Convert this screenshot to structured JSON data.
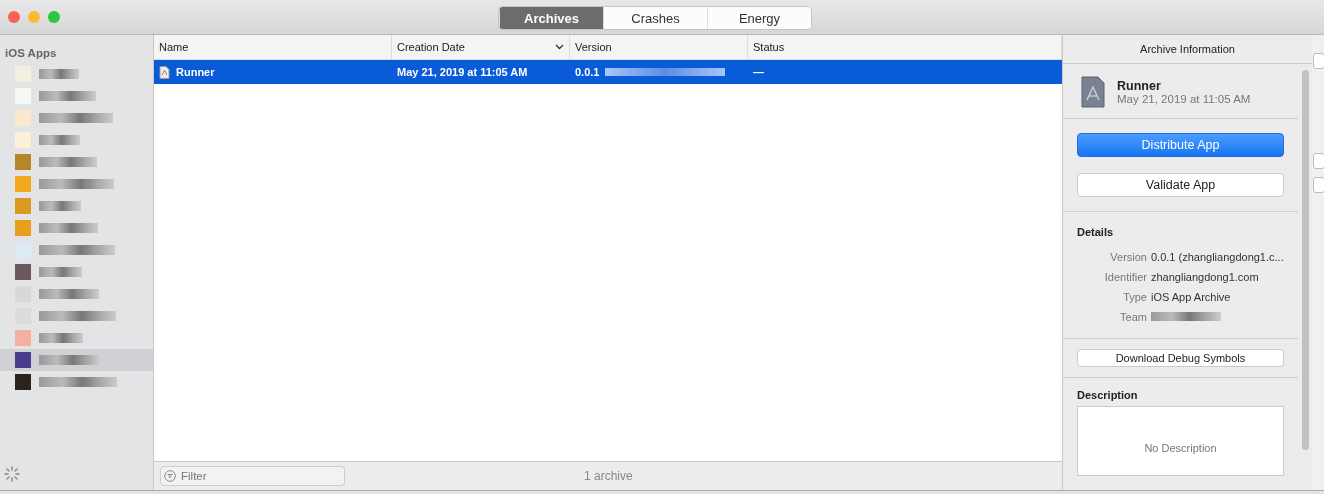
{
  "tabs": [
    {
      "label": "Archives",
      "selected": true
    },
    {
      "label": "Crashes",
      "selected": false
    },
    {
      "label": "Energy",
      "selected": false
    }
  ],
  "sidebar": {
    "heading": "iOS Apps",
    "items": [
      {
        "color": "#f4f0e0",
        "selected": false
      },
      {
        "color": "#f8f8f4",
        "selected": false
      },
      {
        "color": "#fbe9cc",
        "selected": false
      },
      {
        "color": "#fbf0d8",
        "selected": false
      },
      {
        "color": "#b8862a",
        "selected": false
      },
      {
        "color": "#f0a81c",
        "selected": false
      },
      {
        "color": "#d99a24",
        "selected": false
      },
      {
        "color": "#e8a01c",
        "selected": false
      },
      {
        "color": "#dcecf4",
        "selected": false
      },
      {
        "color": "#6a5a60",
        "selected": false
      },
      {
        "color": "#d8d8d8",
        "selected": false
      },
      {
        "color": "#dcdcdc",
        "selected": false
      },
      {
        "color": "#f4b0a0",
        "selected": false
      },
      {
        "color": "#4a3c8c",
        "selected": true
      },
      {
        "color": "#2a2420",
        "selected": false
      }
    ]
  },
  "table": {
    "columns": [
      "Name",
      "Creation Date",
      "Version",
      "Status"
    ],
    "rows": [
      {
        "name": "Runner",
        "date": "May 21, 2019 at 11:05 AM",
        "version": "0.0.1",
        "status": "—",
        "selected": true
      }
    ]
  },
  "filter": {
    "placeholder": "Filter"
  },
  "footer_count": "1 archive",
  "info": {
    "title": "Archive Information",
    "name": "Runner",
    "date": "May 21, 2019 at 11:05 AM",
    "primary_button": "Distribute App",
    "secondary_button": "Validate App",
    "details_heading": "Details",
    "details": [
      {
        "label": "Version",
        "value": "0.0.1 (zhangliangdong1.c..."
      },
      {
        "label": "Identifier",
        "value": "zhangliangdong1.com"
      },
      {
        "label": "Type",
        "value": "iOS App Archive"
      },
      {
        "label": "Team",
        "redacted": true
      }
    ],
    "symbols_button": "Download Debug Symbols",
    "description_heading": "Description",
    "description_placeholder": "No Description"
  }
}
